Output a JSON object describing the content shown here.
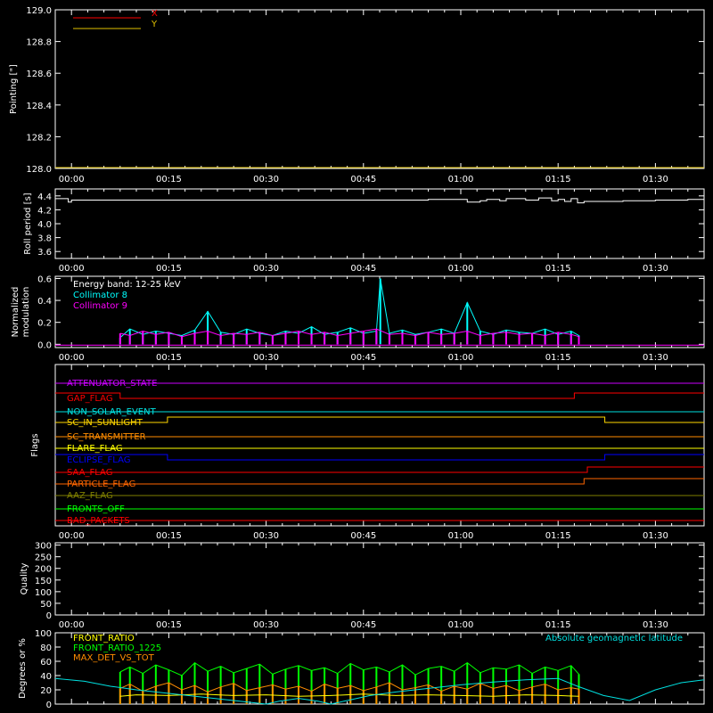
{
  "chart_data": [
    {
      "type": "line",
      "ylabel": "Pointing [\"]",
      "ylim": [
        128.0,
        129.0
      ],
      "yticks": [
        "128.0",
        "128.2",
        "128.4",
        "128.6",
        "128.8",
        "129.0"
      ],
      "ytick_values": [
        128.0,
        128.2,
        128.4,
        128.6,
        128.8,
        129.0
      ],
      "xticks": [
        "00:00",
        "00:15",
        "00:30",
        "00:45",
        "01:00",
        "01:15",
        "01:30"
      ],
      "xtick_minutes": [
        0,
        15,
        30,
        45,
        60,
        75,
        90
      ],
      "xlim_minutes": [
        -2.5,
        97.5
      ],
      "legend_position": "top-left",
      "series": [
        {
          "name": "X",
          "color": "#ff0000",
          "x": [],
          "y": []
        },
        {
          "name": "Y",
          "color": "#e0c000",
          "x": [],
          "y": []
        }
      ]
    },
    {
      "type": "line",
      "ylabel": "Roll period [s]",
      "ylim": [
        3.5,
        4.5
      ],
      "yticks": [
        "3.6",
        "3.8",
        "4.0",
        "4.2",
        "4.4"
      ],
      "ytick_values": [
        3.6,
        3.8,
        4.0,
        4.2,
        4.4
      ],
      "xticks": [
        "00:00",
        "00:15",
        "00:30",
        "00:45",
        "01:00",
        "01:15",
        "01:30"
      ],
      "xtick_minutes": [
        0,
        15,
        30,
        45,
        60,
        75,
        90
      ],
      "xlim_minutes": [
        -2.5,
        97.5
      ],
      "series": [
        {
          "name": "",
          "color": "#ffffff",
          "x": [
            -2.5,
            -0.5,
            -0.5,
            0,
            0,
            3,
            10,
            20,
            30,
            40,
            50,
            55,
            58,
            60,
            61,
            63,
            64,
            66,
            67,
            70,
            72,
            74,
            75,
            76,
            77,
            78,
            79,
            80,
            85,
            90,
            95,
            97.5
          ],
          "y": [
            4.36,
            4.36,
            4.31,
            4.31,
            4.34,
            4.34,
            4.34,
            4.34,
            4.34,
            4.34,
            4.34,
            4.35,
            4.35,
            4.35,
            4.31,
            4.33,
            4.35,
            4.33,
            4.36,
            4.34,
            4.37,
            4.33,
            4.35,
            4.32,
            4.36,
            4.3,
            4.32,
            4.32,
            4.33,
            4.34,
            4.35,
            4.36
          ]
        }
      ]
    },
    {
      "type": "line",
      "ylabel": "Normalized modulation",
      "ylim": [
        -0.03,
        0.62
      ],
      "yticks": [
        "0.0",
        "0.2",
        "0.4",
        "0.6"
      ],
      "ytick_values": [
        0.0,
        0.2,
        0.4,
        0.6
      ],
      "xticks": [
        "00:00",
        "00:15",
        "00:30",
        "00:45",
        "01:00",
        "01:15",
        "01:30"
      ],
      "xtick_minutes": [
        0,
        15,
        30,
        45,
        60,
        75,
        90
      ],
      "xlim_minutes": [
        -2.5,
        97.5
      ],
      "annotations": [
        "Energy band: 12-25 keV"
      ],
      "legend_position": "top-left",
      "series": [
        {
          "name": "Collimator 8",
          "color": "#00ffff",
          "x": [
            7.5,
            9,
            11,
            13,
            15,
            17,
            19,
            21,
            23,
            25,
            27,
            29,
            31,
            33,
            35,
            37,
            39,
            41,
            43,
            45,
            47,
            47.6,
            49,
            51,
            53,
            55,
            57,
            59,
            61,
            63,
            65,
            67,
            69,
            71,
            73,
            75,
            77,
            78.2
          ],
          "y": [
            0.06,
            0.14,
            0.09,
            0.12,
            0.1,
            0.08,
            0.13,
            0.3,
            0.11,
            0.09,
            0.14,
            0.1,
            0.08,
            0.12,
            0.1,
            0.16,
            0.09,
            0.11,
            0.15,
            0.1,
            0.12,
            0.6,
            0.1,
            0.13,
            0.09,
            0.11,
            0.14,
            0.1,
            0.38,
            0.12,
            0.09,
            0.13,
            0.11,
            0.1,
            0.14,
            0.09,
            0.12,
            0.08
          ]
        },
        {
          "name": "Collimator 9",
          "color": "#ff00ff",
          "x": [
            7.5,
            9,
            11,
            13,
            15,
            17,
            19,
            21,
            23,
            25,
            27,
            29,
            31,
            33,
            35,
            37,
            39,
            41,
            43,
            45,
            47,
            49,
            51,
            53,
            55,
            57,
            59,
            61,
            63,
            65,
            67,
            69,
            71,
            73,
            75,
            77,
            78.2
          ],
          "y": [
            0.1,
            0.08,
            0.12,
            0.09,
            0.11,
            0.07,
            0.1,
            0.12,
            0.08,
            0.1,
            0.09,
            0.11,
            0.08,
            0.1,
            0.12,
            0.09,
            0.11,
            0.08,
            0.1,
            0.12,
            0.14,
            0.09,
            0.1,
            0.08,
            0.11,
            0.09,
            0.1,
            0.12,
            0.08,
            0.1,
            0.11,
            0.09,
            0.1,
            0.08,
            0.11,
            0.09,
            0.07
          ]
        }
      ]
    },
    {
      "type": "line",
      "ylabel": "Flags",
      "xticks": [
        "00:00",
        "00:15",
        "00:30",
        "00:45",
        "01:00",
        "01:15",
        "01:30"
      ],
      "xtick_minutes": [
        0,
        15,
        30,
        45,
        60,
        75,
        90
      ],
      "xlim_minutes": [
        -2.5,
        97.5
      ],
      "series": [
        {
          "name": "ATTENUATOR_STATE",
          "color": "#cc00ff",
          "x": [
            -2.5,
            97.5
          ],
          "y": [
            0,
            0
          ]
        },
        {
          "name": "GAP_FLAG",
          "color": "#ff0000",
          "x": [
            -2.5,
            7.5,
            7.5,
            77.5,
            77.5,
            97.5
          ],
          "y": [
            1,
            1,
            0,
            0,
            1,
            1
          ]
        },
        {
          "name": "NON_SOLAR_EVENT",
          "color": "#00e0e0",
          "x": [
            -2.5,
            97.5
          ],
          "y": [
            0,
            0
          ]
        },
        {
          "name": "SC_IN_SUNLIGHT",
          "color": "#ffd700",
          "x": [
            -2.5,
            14.8,
            14.8,
            82.2,
            82.2,
            97.5
          ],
          "y": [
            0,
            0,
            1,
            1,
            0,
            0
          ]
        },
        {
          "name": "SC_TRANSMITTER",
          "color": "#ff8c00",
          "x": [
            -2.5,
            97.5
          ],
          "y": [
            0,
            0
          ]
        },
        {
          "name": "FLARE_FLAG",
          "color": "#ffff00",
          "x": [
            -2.5,
            97.5
          ],
          "y": [
            0,
            0
          ]
        },
        {
          "name": "ECLIPSE_FLAG",
          "color": "#0000ff",
          "x": [
            -2.5,
            14.8,
            14.8,
            82.2,
            82.2,
            97.5
          ],
          "y": [
            1,
            1,
            0,
            0,
            1,
            1
          ]
        },
        {
          "name": "SAA_FLAG",
          "color": "#ff0000",
          "x": [
            -2.5,
            79.5,
            79.5,
            97.5
          ],
          "y": [
            0,
            0,
            1,
            1
          ]
        },
        {
          "name": "PARTICLE_FLAG",
          "color": "#ff6600",
          "x": [
            -2.5,
            79.0,
            79.0,
            97.5
          ],
          "y": [
            0,
            0,
            1,
            1
          ]
        },
        {
          "name": "AAZ_FLAG",
          "color": "#808000",
          "x": [
            -2.5,
            97.5
          ],
          "y": [
            0,
            0
          ]
        },
        {
          "name": "FRONTS_OFF",
          "color": "#00ff00",
          "x": [
            -2.5,
            97.5
          ],
          "y": [
            0,
            0
          ]
        },
        {
          "name": "BAD_PACKETS",
          "color": "#ff0000",
          "x": [
            -2.5,
            97.5
          ],
          "y": [
            0,
            0
          ]
        }
      ]
    },
    {
      "type": "line",
      "ylabel": "Quality",
      "ylim": [
        0,
        310
      ],
      "yticks": [
        "0",
        "50",
        "100",
        "150",
        "200",
        "250",
        "300"
      ],
      "ytick_values": [
        0,
        50,
        100,
        150,
        200,
        250,
        300
      ],
      "xticks": [
        "00:00",
        "00:15",
        "00:30",
        "00:45",
        "01:00",
        "01:15",
        "01:30"
      ],
      "xtick_minutes": [
        0,
        15,
        30,
        45,
        60,
        75,
        90
      ],
      "xlim_minutes": [
        -2.5,
        97.5
      ],
      "series": [
        {
          "name": "",
          "color": "#ffffff",
          "x": [],
          "y": []
        }
      ]
    },
    {
      "type": "line",
      "ylabel": "Degrees or %",
      "ylim": [
        0,
        100
      ],
      "yticks": [
        "0",
        "20",
        "40",
        "60",
        "80",
        "100"
      ],
      "ytick_values": [
        0,
        20,
        40,
        60,
        80,
        100
      ],
      "xlim_minutes": [
        -2.5,
        97.5
      ],
      "legend_position": "top-left",
      "series": [
        {
          "name": "FRONT_RATIO",
          "color": "#ffff00",
          "x": [
            7.5,
            10,
            15,
            20,
            25,
            30,
            35,
            40,
            45,
            50,
            55,
            60,
            65,
            70,
            75,
            78.2
          ],
          "y": [
            11,
            13,
            12,
            14,
            12,
            13,
            11,
            12,
            14,
            12,
            13,
            12,
            11,
            13,
            12,
            11
          ]
        },
        {
          "name": "FRONT_RATIO_1225",
          "color": "#00ff00",
          "x": [
            7.5,
            9,
            11,
            13,
            15,
            17,
            19,
            21,
            23,
            25,
            27,
            29,
            31,
            33,
            35,
            37,
            39,
            41,
            43,
            45,
            47,
            49,
            51,
            53,
            55,
            57,
            59,
            61,
            63,
            65,
            67,
            69,
            71,
            73,
            75,
            77,
            78.2
          ],
          "y": [
            45,
            52,
            43,
            55,
            48,
            40,
            58,
            46,
            53,
            44,
            50,
            56,
            42,
            49,
            54,
            47,
            51,
            43,
            57,
            48,
            52,
            45,
            55,
            41,
            50,
            53,
            46,
            58,
            44,
            51,
            49,
            55,
            43,
            52,
            47,
            54,
            42
          ]
        },
        {
          "name": "MAX_DET_VS_TOT",
          "color": "#ff8c00",
          "x": [
            7.5,
            9,
            11,
            13,
            15,
            17,
            19,
            21,
            23,
            25,
            27,
            29,
            31,
            33,
            35,
            37,
            39,
            41,
            43,
            45,
            47,
            49,
            51,
            53,
            55,
            57,
            59,
            61,
            63,
            65,
            67,
            69,
            71,
            73,
            75,
            77,
            78.2
          ],
          "y": [
            22,
            28,
            18,
            25,
            30,
            20,
            26,
            17,
            24,
            29,
            19,
            23,
            27,
            21,
            25,
            18,
            28,
            22,
            26,
            19,
            24,
            30,
            20,
            23,
            27,
            18,
            25,
            21,
            29,
            22,
            26,
            19,
            24,
            28,
            20,
            23,
            21
          ]
        },
        {
          "name": "Absolute geomagnetic latitude",
          "color": "#00e0e0",
          "x": [
            -2.5,
            2,
            6,
            10,
            15,
            20,
            25,
            30,
            32,
            35,
            38,
            40,
            42,
            44,
            46,
            50,
            55,
            60,
            65,
            70,
            75,
            78,
            82,
            86,
            90,
            94,
            97.5
          ],
          "y": [
            36,
            32,
            25,
            20,
            15,
            10,
            5,
            0,
            4,
            8,
            4,
            0,
            4,
            8,
            12,
            17,
            22,
            27,
            31,
            34,
            36,
            25,
            12,
            5,
            20,
            30,
            34
          ]
        }
      ]
    }
  ]
}
